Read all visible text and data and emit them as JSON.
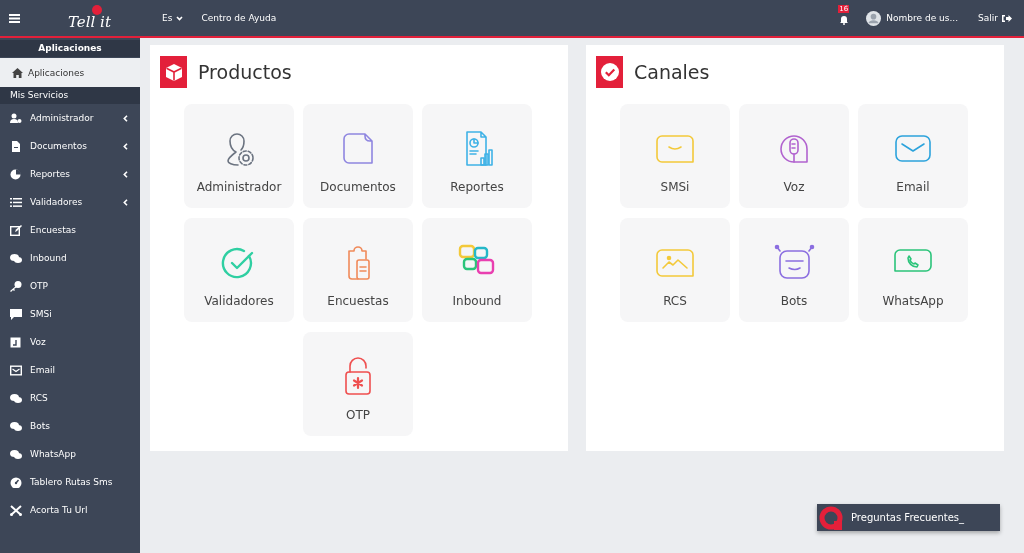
{
  "topbar": {
    "logo": "Tell it",
    "language": "Es",
    "help": "Centro de Ayuda",
    "notifications": "16",
    "user": "Nombre de us...",
    "logout": "Salir"
  },
  "sidebar": {
    "header": "Aplicaciones",
    "top_items": [
      {
        "label": "Aplicaciones",
        "selected": true
      }
    ],
    "section": "Mis Servicios",
    "items": [
      {
        "label": "Administrador",
        "has_submenu": true,
        "selected": false
      },
      {
        "label": "Documentos",
        "has_submenu": true,
        "selected": false
      },
      {
        "label": "Reportes",
        "has_submenu": true,
        "selected": false
      },
      {
        "label": "Validadores",
        "has_submenu": true,
        "selected": false
      },
      {
        "label": "Encuestas",
        "has_submenu": false,
        "selected": false
      },
      {
        "label": "Inbound",
        "has_submenu": false,
        "selected": false
      },
      {
        "label": "OTP",
        "has_submenu": false,
        "selected": false
      },
      {
        "label": "SMSi",
        "has_submenu": false,
        "selected": false
      },
      {
        "label": "Voz",
        "has_submenu": false,
        "selected": false
      },
      {
        "label": "Email",
        "has_submenu": false,
        "selected": false
      },
      {
        "label": "RCS",
        "has_submenu": false,
        "selected": false
      },
      {
        "label": "Bots",
        "has_submenu": false,
        "selected": false
      },
      {
        "label": "WhatsApp",
        "has_submenu": false,
        "selected": false
      },
      {
        "label": "Tablero Rutas Sms",
        "has_submenu": false,
        "selected": false
      },
      {
        "label": "Acorta Tu Url",
        "has_submenu": false,
        "selected": false
      }
    ]
  },
  "panels": [
    {
      "kind": "products",
      "title": "Productos",
      "tiles": [
        {
          "label": "Administrador"
        },
        {
          "label": "Documentos"
        },
        {
          "label": "Reportes"
        },
        {
          "label": "Validadores"
        },
        {
          "label": "Encuestas"
        },
        {
          "label": "Inbound"
        },
        {
          "label": "OTP"
        }
      ]
    },
    {
      "kind": "channels",
      "title": "Canales",
      "tiles": [
        {
          "label": "SMSi"
        },
        {
          "label": "Voz"
        },
        {
          "label": "Email"
        },
        {
          "label": "RCS"
        },
        {
          "label": "Bots"
        },
        {
          "label": "WhatsApp"
        }
      ]
    }
  ],
  "faq": {
    "label": "Preguntas Frecuentes_"
  }
}
